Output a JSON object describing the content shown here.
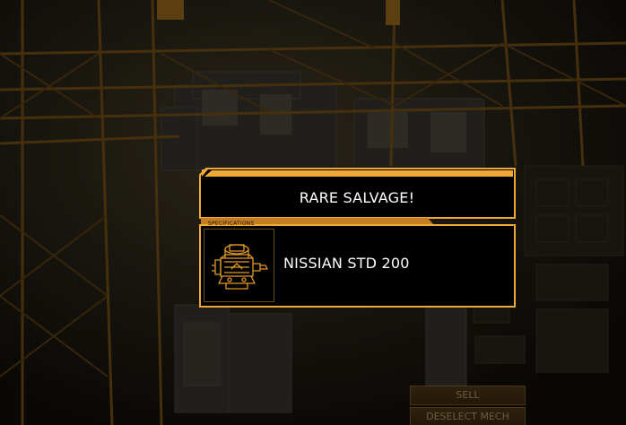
{
  "dialog": {
    "title": "RARE SALVAGE!",
    "section_label": "SPECIFICATIONS",
    "item": {
      "name": "NISSIAN STD 200",
      "icon": "engine-icon"
    }
  },
  "menu": {
    "sell_label": "SELL",
    "deselect_label": "DESELECT MECH"
  },
  "colors": {
    "accent": "#f0a836",
    "frame_dark": "#7a5218",
    "panel_bg": "#000000",
    "text": "#ffffff"
  }
}
